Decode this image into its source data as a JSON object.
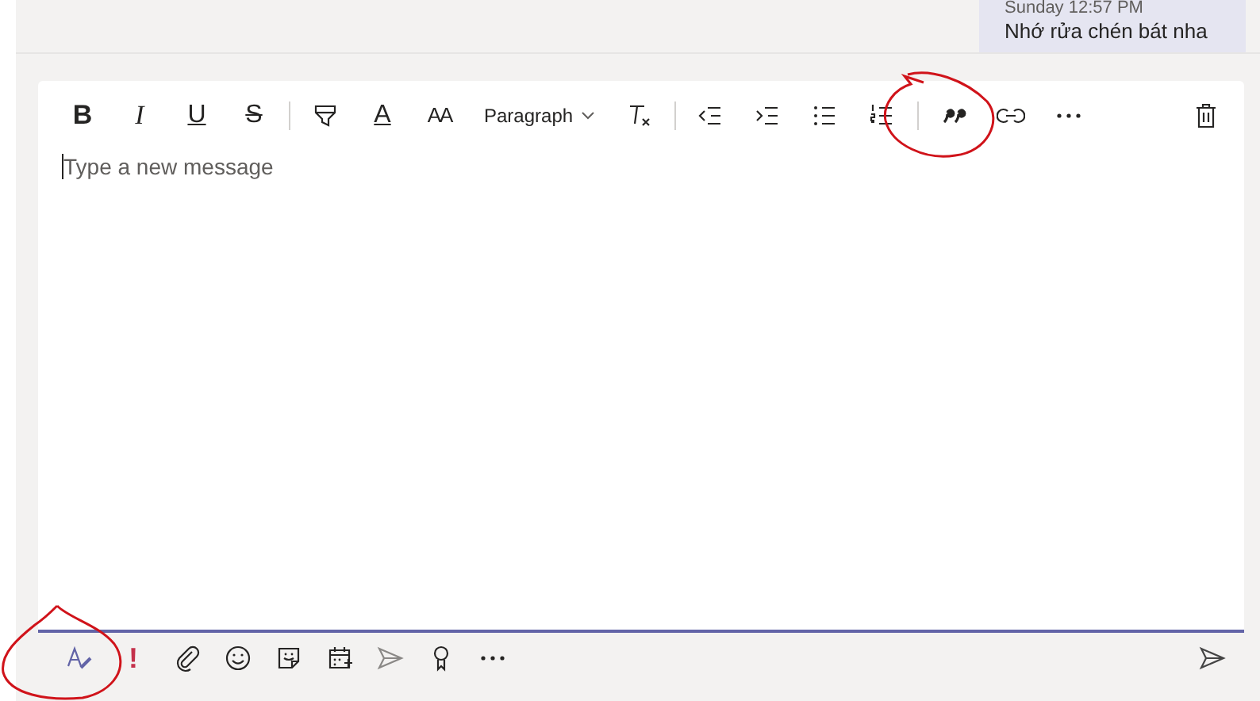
{
  "message": {
    "time": "Sunday 12:57 PM",
    "text": "Nhớ rửa chén bát nha"
  },
  "format_toolbar": [
    {
      "kind": "bold",
      "label": "B"
    },
    {
      "kind": "italic",
      "label": "I"
    },
    {
      "kind": "underline",
      "label": "U"
    },
    {
      "kind": "strike",
      "label": "S"
    },
    {
      "kind": "separator"
    },
    {
      "kind": "highlight"
    },
    {
      "kind": "font-color",
      "label": "A"
    },
    {
      "kind": "font-size",
      "label": "AA"
    },
    {
      "kind": "dropdown",
      "label": "Paragraph"
    },
    {
      "kind": "clear-format"
    },
    {
      "kind": "separator"
    },
    {
      "kind": "outdent"
    },
    {
      "kind": "indent"
    },
    {
      "kind": "bullets"
    },
    {
      "kind": "numbering"
    },
    {
      "kind": "separator"
    },
    {
      "kind": "quote"
    },
    {
      "kind": "link"
    },
    {
      "kind": "more"
    },
    {
      "kind": "spacer"
    },
    {
      "kind": "delete"
    }
  ],
  "compose": {
    "placeholder": "Type a new message"
  },
  "bottom_toolbar": [
    {
      "kind": "format"
    },
    {
      "kind": "important",
      "label": "!"
    },
    {
      "kind": "attach"
    },
    {
      "kind": "emoji"
    },
    {
      "kind": "sticker"
    },
    {
      "kind": "schedule"
    },
    {
      "kind": "stream"
    },
    {
      "kind": "praise"
    },
    {
      "kind": "more"
    },
    {
      "kind": "spacer"
    },
    {
      "kind": "send"
    }
  ]
}
